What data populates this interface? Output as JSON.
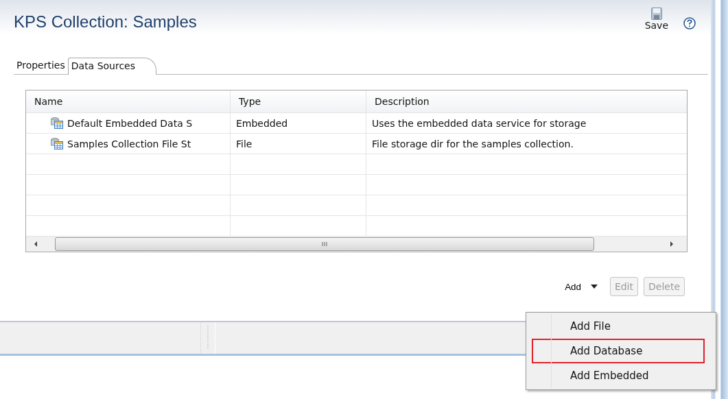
{
  "editor": {
    "title": "KPS Collection: Samples",
    "save_label": "Save"
  },
  "tabs": [
    {
      "label": "Properties",
      "selected": false
    },
    {
      "label": "Data Sources",
      "selected": true
    }
  ],
  "table": {
    "columns": [
      "Name",
      "Type",
      "Description"
    ],
    "rows": [
      {
        "name": "Default Embedded Data S",
        "type": "Embedded",
        "description": "Uses the embedded data service for storage"
      },
      {
        "name": "Samples Collection File St",
        "type": "File",
        "description": "File storage dir for the samples collection."
      }
    ]
  },
  "buttons": [
    {
      "kind": "dropdown",
      "label": "Add",
      "disabled": false
    },
    {
      "kind": "push",
      "label": "Edit",
      "disabled": true
    },
    {
      "kind": "push",
      "label": "Delete",
      "disabled": true
    }
  ],
  "menu": {
    "items": [
      {
        "label": "Add File",
        "highlighted": false
      },
      {
        "label": "Add Database",
        "highlighted": true
      },
      {
        "label": "Add Embedded",
        "highlighted": false
      }
    ]
  }
}
